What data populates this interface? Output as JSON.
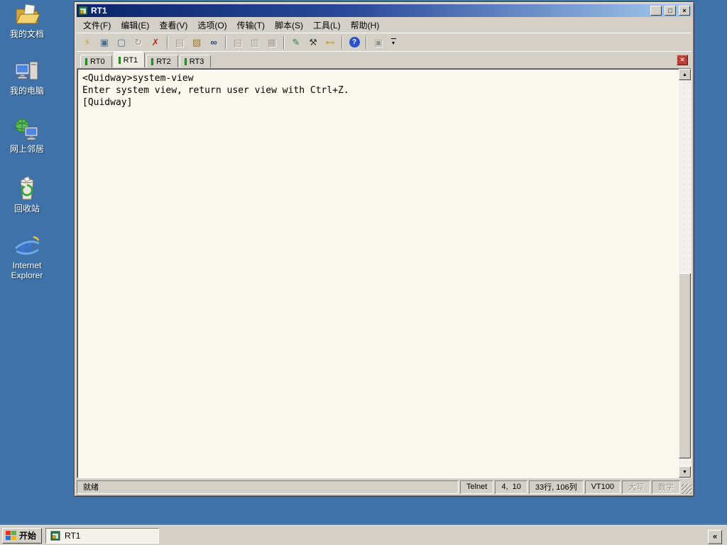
{
  "colors": {
    "desktop_background": "#3E72A8",
    "titlebar_gradient_start": "#0A246A",
    "titlebar_gradient_end": "#A6CAF0",
    "window_chrome": "#D4D0C8",
    "terminal_background": "#FBF9EE",
    "tab_connected_indicator": "#2FA32F",
    "tab_close_button": "#BE3429"
  },
  "desktop": {
    "icons": [
      {
        "name": "my-documents",
        "label": "我的文档"
      },
      {
        "name": "my-computer",
        "label": "我的电脑"
      },
      {
        "name": "network-places",
        "label": "网上邻居"
      },
      {
        "name": "recycle-bin",
        "label": "回收站"
      },
      {
        "name": "internet-explorer",
        "label": "Internet Explorer"
      }
    ]
  },
  "window": {
    "title": "RT1",
    "controls": {
      "minimize": "_",
      "maximize": "□",
      "close": "×"
    },
    "menu": {
      "items": [
        {
          "label": "文件(F)"
        },
        {
          "label": "编辑(E)"
        },
        {
          "label": "查看(V)"
        },
        {
          "label": "选项(O)"
        },
        {
          "label": "传输(T)"
        },
        {
          "label": "脚本(S)"
        },
        {
          "label": "工具(L)"
        },
        {
          "label": "帮助(H)"
        }
      ]
    },
    "toolbar": {
      "icons": [
        {
          "name": "quick-connect",
          "glyph": "⚡"
        },
        {
          "name": "connect",
          "glyph": "▣"
        },
        {
          "name": "connect-in-tab",
          "glyph": "▢"
        },
        {
          "name": "reconnect",
          "glyph": "↻"
        },
        {
          "name": "disconnect",
          "glyph": "✗"
        },
        {
          "name": "copy",
          "glyph": "▤"
        },
        {
          "name": "paste",
          "glyph": "▨"
        },
        {
          "name": "find",
          "glyph": "∞"
        },
        {
          "name": "send-file",
          "glyph": "▤"
        },
        {
          "name": "receive-file",
          "glyph": "▥"
        },
        {
          "name": "print",
          "glyph": "▦"
        },
        {
          "name": "session-options",
          "glyph": "✎"
        },
        {
          "name": "global-options",
          "glyph": "⚒"
        },
        {
          "name": "keygen",
          "glyph": "⊷"
        },
        {
          "name": "help",
          "glyph": "?"
        },
        {
          "name": "activator",
          "glyph": "▣"
        }
      ],
      "overflow_glyph": "▾"
    },
    "tabs": {
      "items": [
        {
          "label": "RT0",
          "active": false
        },
        {
          "label": "RT1",
          "active": true
        },
        {
          "label": "RT2",
          "active": false
        },
        {
          "label": "RT3",
          "active": false
        }
      ],
      "close_glyph": "✕"
    },
    "terminal": {
      "text": "<Quidway>system-view\nEnter system view, return user view with Ctrl+Z.\n[Quidway]"
    },
    "scrollbar": {
      "up_glyph": "▲",
      "down_glyph": "▼"
    },
    "status": {
      "ready": "就绪",
      "protocol": "Telnet",
      "cursor_position": "4,  10",
      "screen_size": "33行, 106列",
      "emulation": "VT100",
      "caps_lock": "大写",
      "num_lock": "数字"
    }
  },
  "taskbar": {
    "start_label": "开始",
    "tasks": [
      {
        "label": "RT1"
      }
    ],
    "overflow_glyph": "«"
  }
}
